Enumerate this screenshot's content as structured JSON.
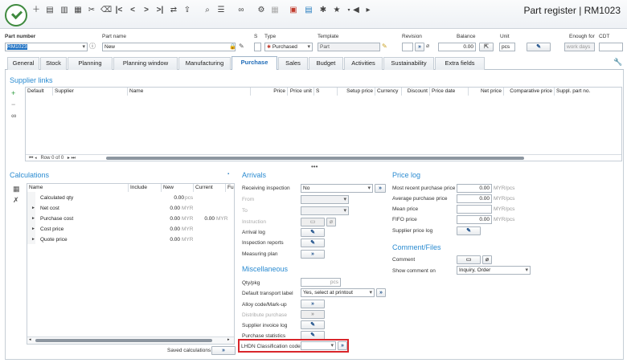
{
  "window": {
    "title": "Part register | RM1023"
  },
  "toolbar": {
    "icons": [
      "app-logo",
      "new-icon",
      "save-icon",
      "save-as-icon",
      "calendar-icon",
      "scissors-icon",
      "eraser-icon",
      "first-icon",
      "previous-icon",
      "next-icon",
      "last-icon",
      "transfer-icon",
      "export-icon",
      "search-icon",
      "search-list-icon",
      "refresh-icon",
      "link-icon",
      "link-settings-icon",
      "grid-icon",
      "color-palette-icon",
      "table-icon",
      "star-icon",
      "favorite-menu-icon",
      "back-icon",
      "forward-icon"
    ]
  },
  "header": {
    "part_number_label": "Part number",
    "part_number_value": "RM1023",
    "part_name_label": "Part name",
    "part_name_value": "New",
    "s_label": "S",
    "type_label": "Type",
    "type_value": "Purchased",
    "template_label": "Template",
    "template_value": "Part",
    "revision_label": "Revision",
    "balance_label": "Balance",
    "balance_value": "0.00",
    "unit_label": "Unit",
    "unit_value": "pcs",
    "enough_for_label": "Enough for",
    "enough_for_value": "work days",
    "cdt_label": "CDT"
  },
  "tabs": [
    "General",
    "Stock",
    "Planning",
    "Planning window",
    "Manufacturing",
    "Purchase",
    "Sales",
    "Budget",
    "Activities",
    "Sustainability",
    "Extra fields"
  ],
  "active_tab": "Purchase",
  "supplier_links": {
    "title": "Supplier links",
    "columns": [
      "Default",
      "Supplier",
      "Name",
      "Price",
      "Price unit",
      "S",
      "Setup price",
      "Currency",
      "Discount",
      "Price date",
      "Net price",
      "Comparative price",
      "Suppl. part no."
    ],
    "footer": "Row 0 of 0"
  },
  "calculations": {
    "title": "Calculations",
    "columns": [
      "Name",
      "Include",
      "New",
      "Current",
      "Fu"
    ],
    "rows": [
      {
        "name": "Calculated qty",
        "new": "0.00",
        "new_unit": "pcs",
        "current": "",
        "current_unit": ""
      },
      {
        "name": "Net cost",
        "new": "0.00",
        "new_unit": "MYR",
        "current": "",
        "current_unit": ""
      },
      {
        "name": "Purchase cost",
        "new": "0.00",
        "new_unit": "MYR",
        "current": "0.00",
        "current_unit": "MYR"
      },
      {
        "name": "Cost price",
        "new": "0.00",
        "new_unit": "MYR",
        "current": "",
        "current_unit": ""
      },
      {
        "name": "Quote price",
        "new": "0.00",
        "new_unit": "MYR",
        "current": "",
        "current_unit": ""
      }
    ],
    "saved_label": "Saved calculations"
  },
  "arrivals": {
    "title": "Arrivals",
    "receiving_inspection_label": "Receiving inspection",
    "receiving_inspection_value": "No",
    "from_label": "From",
    "to_label": "To",
    "instruction_label": "Instruction",
    "arrival_log_label": "Arrival log",
    "inspection_reports_label": "Inspection reports",
    "measuring_plan_label": "Measuring plan"
  },
  "misc": {
    "title": "Miscellaneous",
    "qty_pkg_label": "Qty/pkg",
    "qty_pkg_unit": "pcs",
    "default_transport_label": "Default transport label",
    "default_transport_value": "Yes, select at printout",
    "alloy_label": "Alloy code/Mark-up",
    "distribute_label": "Distribute purchase",
    "supplier_invoice_log_label": "Supplier invoice log",
    "purchase_statistics_label": "Purchase statistics",
    "lhdn_label": "LHDN Classification code",
    "lhdn_value": ""
  },
  "price_log": {
    "title": "Price log",
    "rows": [
      {
        "label": "Most recent purchase price",
        "value": "0.00",
        "unit": "MYR/pcs"
      },
      {
        "label": "Average purchase price",
        "value": "0.00",
        "unit": "MYR/pcs"
      },
      {
        "label": "Mean price",
        "value": "",
        "unit": "MYR/pcs"
      },
      {
        "label": "FIFO price",
        "value": "0.00",
        "unit": "MYR/pcs"
      }
    ],
    "supplier_price_log_label": "Supplier price log"
  },
  "comment": {
    "title": "Comment/Files",
    "comment_label": "Comment",
    "show_comment_label": "Show comment on",
    "show_comment_value": "Inquiry, Order"
  },
  "symbols": {
    "go": "»",
    "edit": "✎",
    "dropdown": "▾",
    "expand": "►"
  }
}
